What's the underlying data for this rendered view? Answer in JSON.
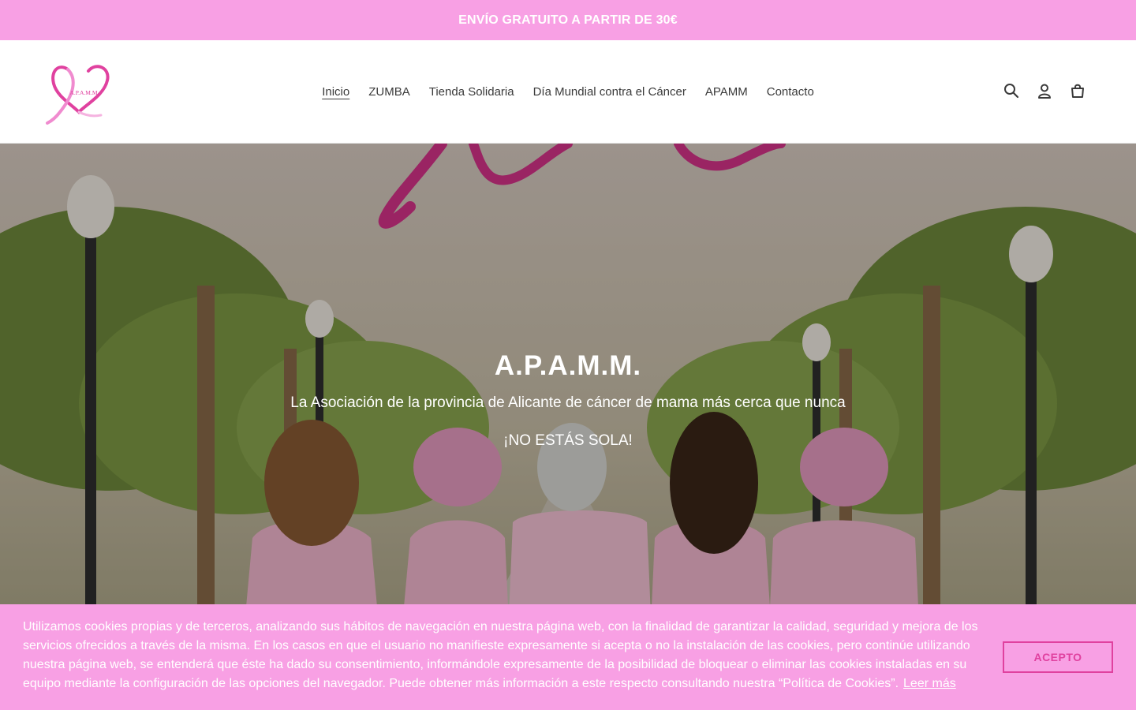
{
  "announcement": {
    "text": "ENVÍO GRATUITO A PARTIR DE 30€"
  },
  "header": {
    "logo_text": "A.P.A.M.M",
    "nav": [
      {
        "label": "Inicio",
        "active": true
      },
      {
        "label": "ZUMBA"
      },
      {
        "label": "Tienda Solidaria"
      },
      {
        "label": "Día Mundial contra el Cáncer"
      },
      {
        "label": "APAMM"
      },
      {
        "label": "Contacto"
      }
    ],
    "icons": [
      "search-icon",
      "account-icon",
      "cart-icon"
    ]
  },
  "hero": {
    "title": "A.P.A.M.M.",
    "subtitle": "La Asociación de la provincia de Alicante de cáncer de mama más cerca que nunca",
    "tagline": "¡NO ESTÁS SOLA!"
  },
  "cookie": {
    "text": "Utilizamos cookies propias y de terceros, analizando sus hábitos de navegación en nuestra página web, con la finalidad de garantizar la calidad, seguridad y mejora de los servicios ofrecidos a través de la misma. En los casos en que el usuario no manifieste expresamente si acepta o no la instalación de las cookies, pero continúe utilizando nuestra página web, se entenderá que éste ha dado su consentimiento, informándole expresamente de la posibilidad de bloquear o eliminar las cookies instaladas en su equipo mediante la configuración de las opciones del navegador. Puede obtener más información a este respecto consultando nuestra “Política de Cookies”.",
    "link": "Leer más",
    "button": "ACEPTO"
  },
  "colors": {
    "brand_pink": "#f8a0e4",
    "accent_magenta": "#e0419f"
  }
}
